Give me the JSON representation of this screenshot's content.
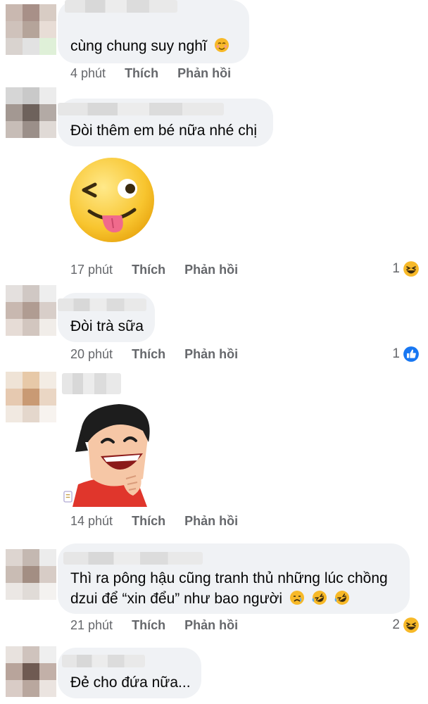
{
  "comments": [
    {
      "text": "cùng chung suy nghĩ",
      "time": "4 phút",
      "like_label": "Thích",
      "reply_label": "Phản hồi",
      "text_emojis": [
        "shy-face-emoji"
      ]
    },
    {
      "text": "Đòi thêm em bé nữa nhé chị",
      "sticker": "winking-tongue-face-sticker",
      "time": "17 phút",
      "like_label": "Thích",
      "reply_label": "Phản hồi",
      "reaction_count": "1",
      "reaction_icon": "laughing-emoji"
    },
    {
      "text": "Đòi trà sữa",
      "time": "20 phút",
      "like_label": "Thích",
      "reply_label": "Phản hồi",
      "reaction_count": "1",
      "reaction_icon": "like-icon"
    },
    {
      "sticker": "laughing-man-sticker",
      "time": "14 phút",
      "like_label": "Thích",
      "reply_label": "Phản hồi"
    },
    {
      "text_line1": "Thì ra pông hậu cũng tranh thủ những lúc chồng",
      "text_line2": "dzui để “xin đểu” như bao người",
      "text_emojis": [
        "crying-face-emoji",
        "rofl-emoji",
        "rofl-emoji"
      ],
      "time": "21 phút",
      "like_label": "Thích",
      "reply_label": "Phản hồi",
      "reaction_count": "2",
      "reaction_icon": "laughing-emoji"
    },
    {
      "text": "Đẻ cho đứa nữa..."
    }
  ],
  "colors": {
    "bubble": "#f0f2f5",
    "meta_text": "#65676b",
    "like_blue": "#1877f2",
    "emoji_yellow": "#f7b928"
  }
}
